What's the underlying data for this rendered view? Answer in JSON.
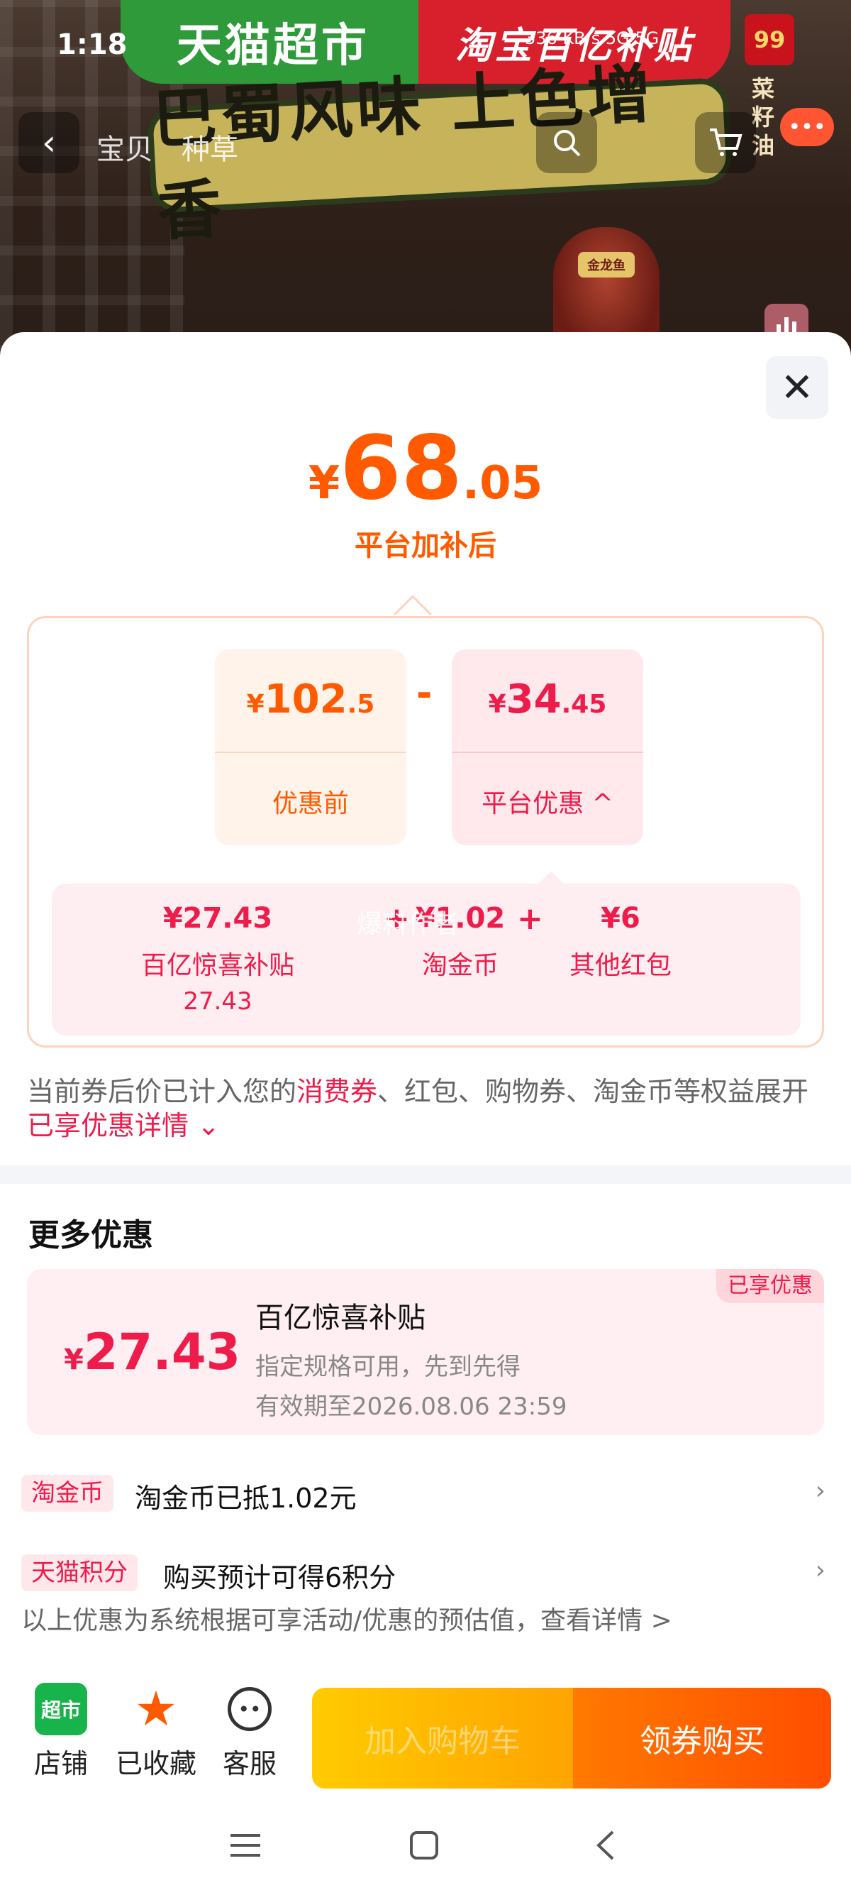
{
  "status_bar": {
    "time": "1:18",
    "icons_text": "336 KB/s  5G  5G"
  },
  "background": {
    "banner_left": "天猫超市",
    "banner_right": "淘宝百亿补贴",
    "plaque_text": "巴蜀风味 上色增香",
    "bottle_label": "金龙鱼",
    "badge_text": "99",
    "vertical_text": "菜籽油"
  },
  "nav": {
    "back_icon": "‹",
    "tab_item": "宝贝",
    "tab_review": "种草",
    "more_icon": "•••"
  },
  "sheet": {
    "close_icon": "✕",
    "final_price": {
      "yen": "¥",
      "int": "68",
      "dec": ".05"
    },
    "final_label": "平台加补后",
    "before": {
      "yen": "¥",
      "int": "102",
      "dec": ".5",
      "label": "优惠前"
    },
    "minus": "-",
    "platform": {
      "yen": "¥",
      "int": "34",
      "dec": ".45",
      "label": "平台优惠",
      "chevron": "^"
    },
    "breakdown": [
      {
        "value": "¥27.43",
        "name": "百亿惊喜补贴",
        "sub": "27.43"
      },
      {
        "value": "¥1.02",
        "name": "淘金币",
        "sub": ""
      },
      {
        "value": "¥6",
        "name": "其他红包",
        "sub": ""
      }
    ],
    "plus": "+",
    "watermark": "爆料作者",
    "note": {
      "part1": "当前券后价已计入您的",
      "hl1": "消费券",
      "part2": "、红包、购物券、淘金币等权益展开",
      "hl2": "已享优惠详情",
      "chevron": "⌄"
    },
    "more_title": "更多优惠",
    "coupon": {
      "tag": "已享优惠",
      "yen": "¥",
      "amount": "27.43",
      "title": "百亿惊喜补贴",
      "desc": "指定规格可用，先到先得",
      "expiry": "有效期至2026.08.06 23:59"
    },
    "rows": [
      {
        "tag": "淘金币",
        "text": "淘金币已抵1.02元",
        "arrow": "›"
      },
      {
        "tag": "天猫积分",
        "text": "购买预计可得6积分",
        "arrow": "›"
      }
    ],
    "footer_note": "以上优惠为系统根据可享活动/优惠的预估值，查看详情 >"
  },
  "bottom_bar": {
    "shop_icon_text": "超市",
    "shop_label": "店铺",
    "fav_label": "已收藏",
    "service_label": "客服",
    "add_cart": "加入购物车",
    "buy": "领券购买"
  },
  "colors": {
    "accent_orange": "#ff5a00",
    "accent_red": "#ee1c4a",
    "tmall_green": "#18b34a"
  }
}
